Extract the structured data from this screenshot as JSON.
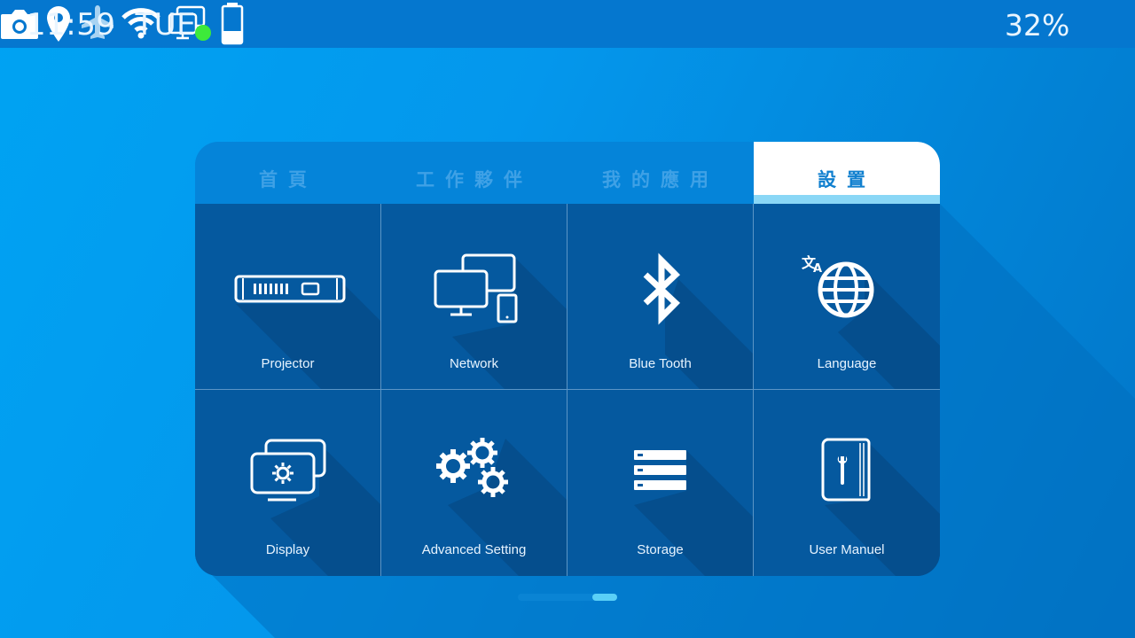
{
  "status_bar": {
    "time": "11:59",
    "day": "TUE",
    "battery_percent": "32%",
    "icons": [
      "camera-icon",
      "location-icon",
      "airplane-icon",
      "wifi-icon",
      "screen-mirror-icon",
      "battery-icon"
    ],
    "battery_level": 0.32,
    "mirror_status_color": "#3dea3a"
  },
  "tabs": [
    {
      "label": "首頁",
      "active": false
    },
    {
      "label": "工作夥伴",
      "active": false
    },
    {
      "label": "我的應用",
      "active": false
    },
    {
      "label": "設置",
      "active": true
    }
  ],
  "settings": [
    {
      "label": "Projector",
      "icon": "projector-icon"
    },
    {
      "label": "Network",
      "icon": "network-icon"
    },
    {
      "label": "Blue Tooth",
      "icon": "bluetooth-icon"
    },
    {
      "label": "Language",
      "icon": "language-icon"
    },
    {
      "label": "Display",
      "icon": "display-icon"
    },
    {
      "label": "Advanced Setting",
      "icon": "gears-icon"
    },
    {
      "label": "Storage",
      "icon": "storage-icon"
    },
    {
      "label": "User Manuel",
      "icon": "manual-icon"
    }
  ],
  "pager": {
    "page_count": 2,
    "current_page": 2
  },
  "colors": {
    "background": "#0497ec",
    "status_bar": "#0577cf",
    "tab_bar": "#0584d9",
    "tab_active": "#ffffff",
    "tab_active_text": "#1180cf",
    "tab_indicator": "#8ad7f6",
    "cell": "#05599f"
  }
}
